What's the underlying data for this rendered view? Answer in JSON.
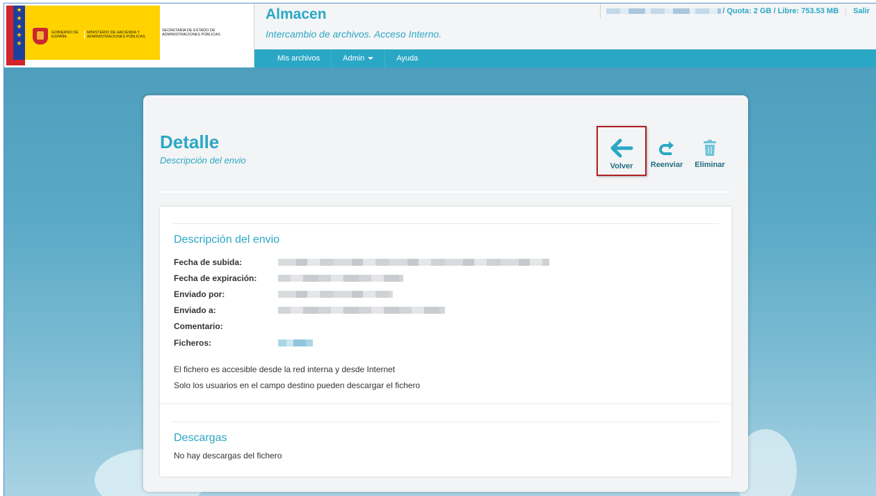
{
  "header": {
    "logo": {
      "gobierno": "GOBIERNO DE ESPAÑA",
      "ministerio": "MINISTERIO DE HACIENDA Y ADMINISTRACIONES PÚBLICAS",
      "secretaria": "SECRETARÍA DE ESTADO DE ADMINISTRACIONES PÚBLICAS"
    },
    "app_title": "Almacen",
    "app_subtitle": "Intercambio de archivos. Acceso Interno.",
    "quota_text": "/ Quota: 2 GB / Libre: 753.53 MB",
    "salir_label": "Salir"
  },
  "nav": {
    "items": [
      "Mis archivos",
      "Admin",
      "Ayuda"
    ]
  },
  "detail": {
    "title": "Detalle",
    "subtitle": "Descripción del envio",
    "actions": {
      "volver": "Volver",
      "reenviar": "Reenviar",
      "eliminar": "Eliminar"
    }
  },
  "panel": {
    "section_title": "Descripción del envio",
    "fields": {
      "fecha_subida": "Fecha de subida:",
      "fecha_expiracion": "Fecha de expiración:",
      "enviado_por": "Enviado por:",
      "enviado_a": "Enviado a:",
      "comentario": "Comentario:",
      "ficheros": "Ficheros:"
    },
    "access_note": "El fichero es accesible desde la red interna y desde Internet",
    "users_note": "Solo los usuarios en el campo destino pueden descargar el fichero",
    "downloads_title": "Descargas",
    "downloads_empty": "No hay descargas del fichero"
  },
  "colors": {
    "accent": "#2ba7c6",
    "highlight_border": "#b01e24"
  }
}
